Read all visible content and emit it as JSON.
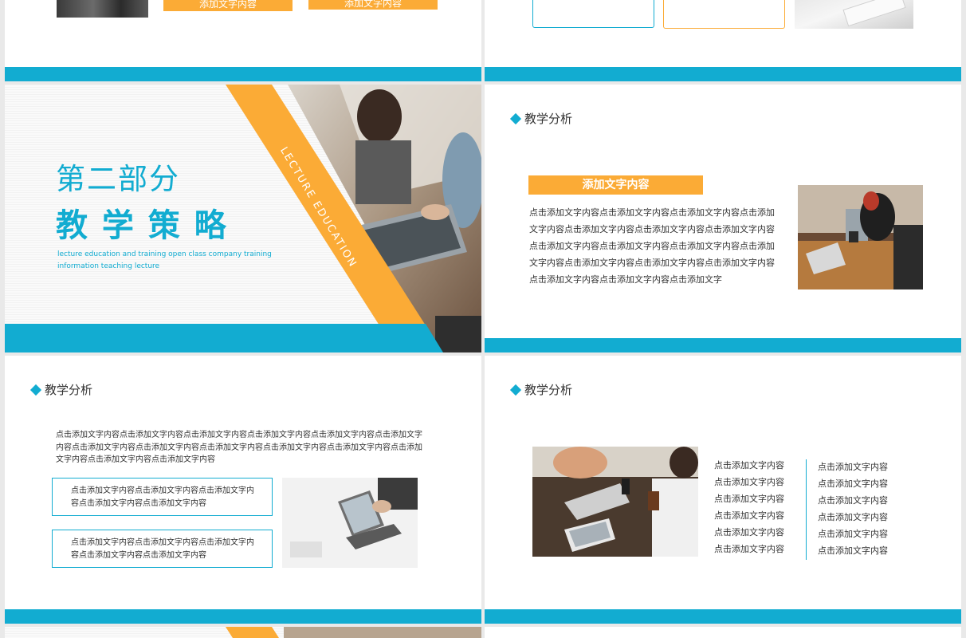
{
  "colors": {
    "accent": "#12acd1",
    "orange": "#fbab36"
  },
  "top_left": {
    "btn1": "添加文字内容",
    "btn2": "添加文字内容"
  },
  "section": {
    "title": "第二部分",
    "subtitle": "教 学 策 略",
    "en_line1": "lecture education and training open class company training",
    "en_line2": "information teaching lecture",
    "ribbon": "LECTURE EDUCATION"
  },
  "slide_a": {
    "heading": "教学分析",
    "banner": "添加文字内容",
    "lines": [
      "点击添加文字内容点击添加文字内容点击添加文字内容点击添加",
      "文字内容点击添加文字内容点击添加文字内容点击添加文字内容",
      "点击添加文字内容点击添加文字内容点击添加文字内容点击添加",
      "文字内容点击添加文字内容点击添加文字内容点击添加文字内容",
      "点击添加文字内容点击添加文字内容点击添加文字"
    ]
  },
  "slide_b": {
    "heading": "教学分析",
    "paragraph": [
      "点击添加文字内容点击添加文字内容点击添加文字内容点击添加文字内容点击添加文字内容点击添加文字",
      "内容点击添加文字内容点击添加文字内容点击添加文字内容点击添加文字内容点击添加文字内容点击添加",
      "文字内容点击添加文字内容点击添加文字内容"
    ],
    "box1": [
      "点击添加文字内容点击添加文字内容点击添加文字内",
      "容点击添加文字内容点击添加文字内容"
    ],
    "box2": [
      "点击添加文字内容点击添加文字内容点击添加文字内",
      "容点击添加文字内容点击添加文字内容"
    ]
  },
  "slide_c": {
    "heading": "教学分析",
    "col1": [
      "点击添加文字内容",
      "点击添加文字内容",
      "点击添加文字内容",
      "点击添加文字内容",
      "点击添加文字内容",
      "点击添加文字内容"
    ],
    "col2": [
      "点击添加文字内容",
      "点击添加文字内容",
      "点击添加文字内容",
      "点击添加文字内容",
      "点击添加文字内容",
      "点击添加文字内容"
    ]
  }
}
